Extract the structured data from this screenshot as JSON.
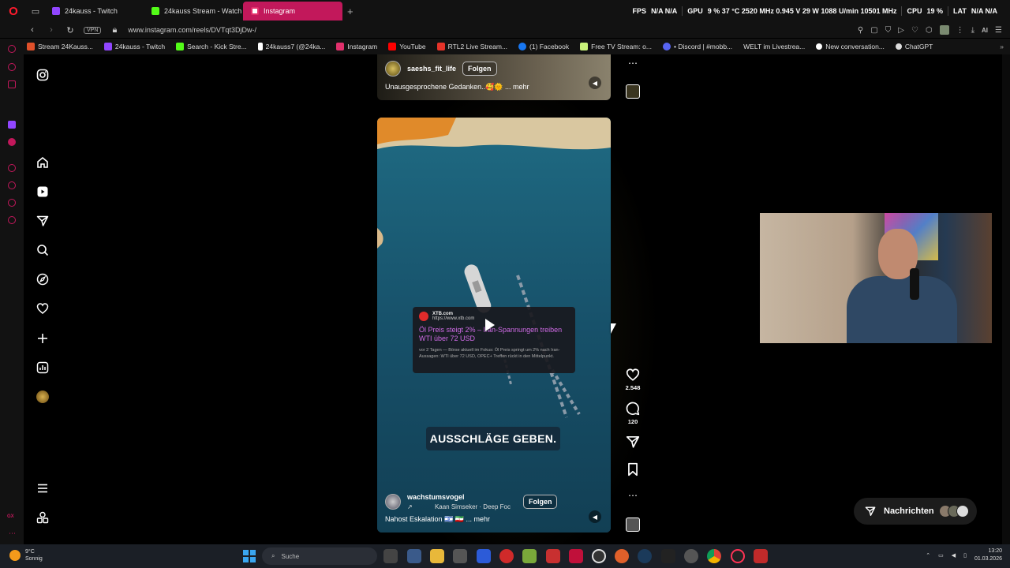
{
  "browser": {
    "tabs": [
      {
        "label": "24kauss - Twitch",
        "color": "#9146ff",
        "active": false
      },
      {
        "label": "24kauss Stream - Watch l",
        "color": "#53fc18",
        "active": false
      },
      {
        "label": "Instagram",
        "color": "#e1306c",
        "active": true
      }
    ],
    "stats": {
      "fps_label": "FPS",
      "fps_value": "N/A N/A",
      "gpu_label": "GPU",
      "gpu_value": "9 % 37 °C 2520 MHz 0.945 V 29 W 1088 U/min 10501 MHz",
      "cpu_label": "CPU",
      "cpu_value": "19 %",
      "lat_label": "LAT",
      "lat_value": "N/A N/A"
    },
    "vpn_label": "VPN",
    "url": "www.instagram.com/reels/DVTqt3DjDw-/",
    "ai_label": "AI",
    "bookmarks": [
      {
        "label": "Stream 24Kauss...",
        "color": "#e0502a"
      },
      {
        "label": "24kauss - Twitch",
        "color": "#9146ff"
      },
      {
        "label": "Search - Kick Stre...",
        "color": "#53fc18"
      },
      {
        "label": "24kauss7 (@24ka...",
        "color": "#ffffff"
      },
      {
        "label": "Instagram",
        "color": "#e1306c"
      },
      {
        "label": "YouTube",
        "color": "#ff0000"
      },
      {
        "label": "RTL2 Live Stream...",
        "color": "#e63329"
      },
      {
        "label": "(1) Facebook",
        "color": "#1877f2"
      },
      {
        "label": "Free TV Stream: o...",
        "color": "#c9f27a"
      },
      {
        "label": "• Discord | #mobb...",
        "color": "#5865f2"
      },
      {
        "label": "WELT im Livestrea...",
        "color": "#333333"
      },
      {
        "label": "New conversation...",
        "color": "#ffffff"
      },
      {
        "label": "ChatGPT",
        "color": "#dddddd"
      }
    ]
  },
  "reel_top": {
    "username": "saeshs_fit_life",
    "follow_label": "Folgen",
    "caption": "Unausgesprochene Gedanken..🥰🌞 ... mehr"
  },
  "reel_main": {
    "news_source": "XTB.com",
    "news_url": "https://www.xtb.com",
    "news_title": "Öl Preis steigt 2% – Iran-Spannungen treiben WTI über 72 USD",
    "news_body": "vor 2 Tagen — Börse aktuell im Fokus: Öl Preis springt um 2% nach Iran-Aussagen: WTI über 72 USD, OPEC+ Treffen rückt in den Mittelpunkt.",
    "subtitle": "AUSSCHLÄGE GEBEN.",
    "username": "wachstumsvogel",
    "audio": "Kaan Simseker · Deep Foc",
    "follow_label": "Folgen",
    "caption": "Nahost Eskalation 🇮🇱 🇮🇷 ... mehr"
  },
  "actions": {
    "likes": "2.548",
    "comments": "120"
  },
  "messages_label": "Nachrichten",
  "taskbar": {
    "weather_temp": "9°C",
    "weather_desc": "Sonnig",
    "search_placeholder": "Suche",
    "time": "13:20",
    "date": "01.03.2026"
  },
  "icons": {
    "ig_nav": [
      "instagram-icon",
      "home-icon",
      "reels-icon",
      "messages-icon",
      "search-icon",
      "explore-icon",
      "notifications-icon",
      "create-icon",
      "dashboard-icon",
      "profile-avatar",
      "menu-icon",
      "apps-icon"
    ]
  }
}
